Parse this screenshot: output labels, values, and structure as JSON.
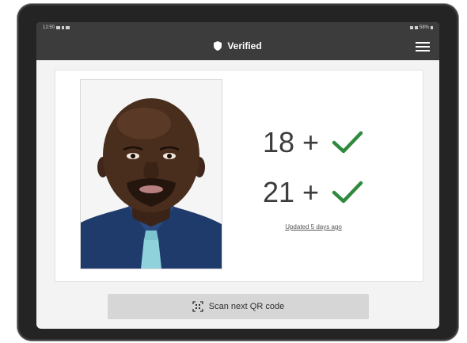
{
  "status_bar": {
    "time": "12:50",
    "battery": "58%"
  },
  "app_bar": {
    "title": "Verified",
    "title_icon": "shield-icon",
    "menu_icon": "hamburger-menu-icon"
  },
  "verification": {
    "photo": "portrait-photo",
    "checks": [
      {
        "label": "18 +",
        "status": "check-icon"
      },
      {
        "label": "21 +",
        "status": "check-icon"
      }
    ],
    "updated_text": "Updated 5 days ago"
  },
  "actions": {
    "scan_label": "Scan next QR code",
    "scan_icon": "qr-scan-icon"
  },
  "colors": {
    "app_bar": "#3c3c3c",
    "check": "#2f8a3e",
    "button": "#d6d6d6",
    "background": "#f3f3f3"
  }
}
